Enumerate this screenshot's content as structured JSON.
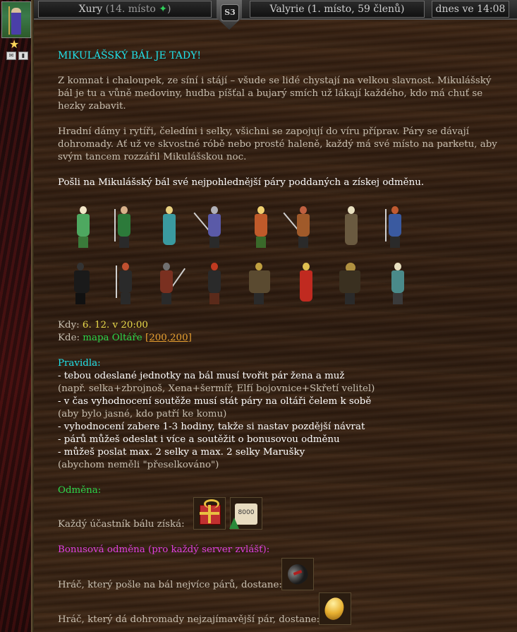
{
  "header": {
    "player_name": "Xury",
    "player_rank": "(14. místo",
    "player_rank_close": ")",
    "server_badge": "S3",
    "clan": "Valyrie (1. místo, 59 členů)",
    "time": "dnes ve 14:08"
  },
  "colors": {
    "title": "#20e0e8",
    "green": "#2dd64a",
    "magenta": "#e040e0",
    "link": "#e8a030"
  },
  "article": {
    "title": "MIKULÁŠSKÝ BÁL JE TADY!",
    "para1": "Z komnat i chaloupek, ze síní i stájí – všude se lidé chystají na velkou slavnost. Mikulášský bál je tu a vůně medoviny, hudba píšťal a bujarý smích už lákají každého, kdo má chuť se hezky zabavit.",
    "para2": "Hradní dámy i rytíři, čeledíni i selky, všichni se zapojují do víru příprav. Páry se dávají dohromady. Ať už ve skvostné róbě nebo prosté haleně, každý má své místo na parketu, aby svým tancem rozzářil Mikulášskou noc.",
    "call": "Pošli na Mikulášský bál své nejpohlednější páry poddaných a získej odměnu.",
    "when_label": "Kdy:",
    "when_value": "6. 12. v 20:00",
    "where_label": "Kde:",
    "where_value": "mapa Oltáře",
    "where_link": "[200,200]",
    "rules_title": "Pravidla:",
    "rules": [
      "- tebou odeslané jednotky na bál musí tvořit pár žena a muž",
      "(např. selka+zbrojnoš, Xena+šermíř, Elfí bojovnice+Skřetí velitel)",
      "- v čas vyhodnocení soutěže musí stát páry na oltáři čelem k sobě",
      "(aby bylo jasné, kdo patří ke komu)",
      "- vyhodnocení zabere 1-3 hodiny, takže si nastav pozdější návrat",
      "- párů můžeš odeslat i více a soutěžit o bonusovou odměnu",
      "- můžeš poslat max. 2 selky a max. 2 selky Marušky",
      "(abychom neměli \"přeselkováno\")"
    ],
    "reward_title": "Odměna:",
    "reward_text": "Každý účastník bálu získá:",
    "reward_scroll": "8000",
    "bonus_title": "Bonusová odměna (pro každý server zvlášť):",
    "bonus1": "Hráč, který pošle na bál nejvíce párů, dostane:",
    "bonus2": "Hráč, který dá dohromady nejzajímavější pár, dostane:"
  },
  "units": {
    "row1": [
      "elf-woman",
      "ranger",
      "maiden",
      "halberdier",
      "elf-warrior",
      "knight",
      "monk",
      "swordsman"
    ],
    "row2": [
      "dark-knight",
      "black-warrior",
      "halberd-guard",
      "red-haired-woman",
      "armored-beast",
      "fire-maiden",
      "orc-warlord",
      "small-elf"
    ]
  }
}
